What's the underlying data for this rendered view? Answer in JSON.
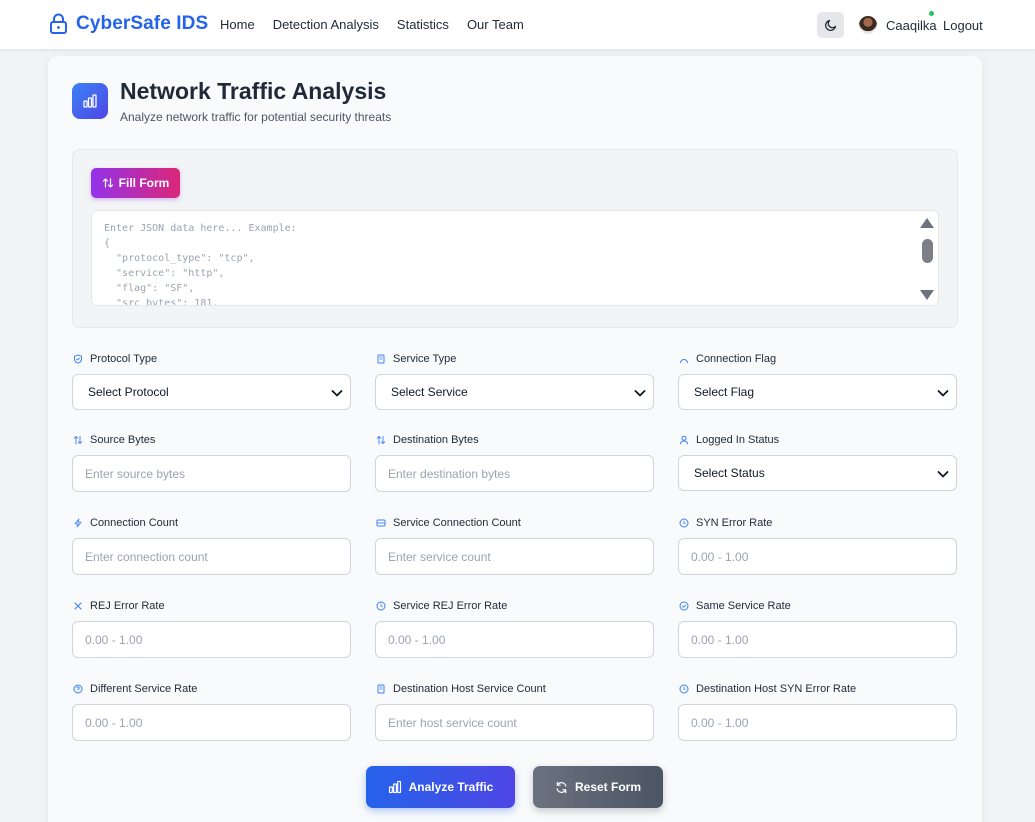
{
  "navbar": {
    "brand": "CyberSafe IDS",
    "links": [
      "Home",
      "Detection Analysis",
      "Statistics",
      "Our Team"
    ],
    "username": "Caaqilka",
    "logout": "Logout"
  },
  "header": {
    "title": "Network Traffic Analysis",
    "subtitle": "Analyze network traffic for potential security threats"
  },
  "json_panel": {
    "fill_button": "Fill Form",
    "placeholder": "Enter JSON data here... Example:\n{\n  \"protocol_type\": \"tcp\",\n  \"service\": \"http\",\n  \"flag\": \"SF\",\n  \"src_bytes\": 181,"
  },
  "fields": {
    "protocol_type": {
      "label": "Protocol Type",
      "value": "Select Protocol"
    },
    "service_type": {
      "label": "Service Type",
      "value": "Select Service"
    },
    "connection_flag": {
      "label": "Connection Flag",
      "value": "Select Flag"
    },
    "source_bytes": {
      "label": "Source Bytes",
      "placeholder": "Enter source bytes"
    },
    "destination_bytes": {
      "label": "Destination Bytes",
      "placeholder": "Enter destination bytes"
    },
    "logged_in": {
      "label": "Logged In Status",
      "value": "Select Status"
    },
    "connection_count": {
      "label": "Connection Count",
      "placeholder": "Enter connection count"
    },
    "service_connection_count": {
      "label": "Service Connection Count",
      "placeholder": "Enter service count"
    },
    "syn_error_rate": {
      "label": "SYN Error Rate",
      "placeholder": "0.00 - 1.00"
    },
    "rej_error_rate": {
      "label": "REJ Error Rate",
      "placeholder": "0.00 - 1.00"
    },
    "service_rej_error_rate": {
      "label": "Service REJ Error Rate",
      "placeholder": "0.00 - 1.00"
    },
    "same_service_rate": {
      "label": "Same Service Rate",
      "placeholder": "0.00 - 1.00"
    },
    "different_service_rate": {
      "label": "Different Service Rate",
      "placeholder": "0.00 - 1.00"
    },
    "dst_host_service_count": {
      "label": "Destination Host Service Count",
      "placeholder": "Enter host service count"
    },
    "dst_host_syn_error_rate": {
      "label": "Destination Host SYN Error Rate",
      "placeholder": "0.00 - 1.00"
    }
  },
  "actions": {
    "analyze": "Analyze Traffic",
    "reset": "Reset Form"
  },
  "colors": {
    "brand": "#2563eb",
    "fill_gradient": [
      "#9333ea",
      "#db2777"
    ],
    "analyze_gradient": [
      "#2563eb",
      "#4f46e5"
    ],
    "reset_gradient": [
      "#6b7280",
      "#4b5563"
    ],
    "label_icon": "#3b82f6",
    "online": "#22c55e"
  },
  "icons": {
    "brand": "lock-icon",
    "theme": "moon-icon",
    "header": "bar-chart-icon",
    "fill": "arrows-up-down-icon",
    "analyze": "bar-chart-icon",
    "reset": "refresh-icon"
  }
}
